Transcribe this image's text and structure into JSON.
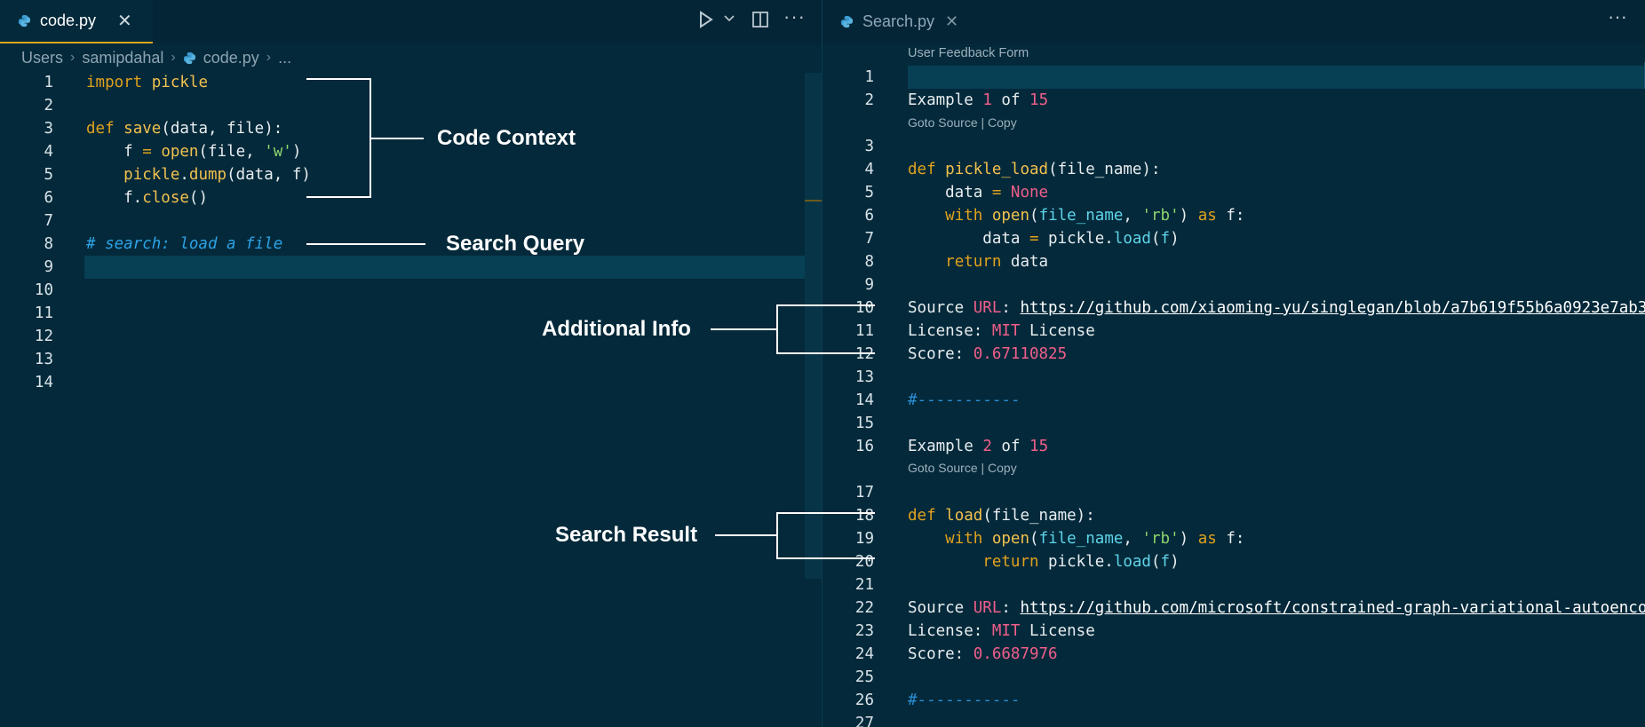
{
  "left_editor": {
    "tab": {
      "label": "code.py"
    },
    "breadcrumb": {
      "items": [
        "Users",
        "samipdahal",
        "code.py",
        "..."
      ]
    },
    "line_numbers": [
      "1",
      "2",
      "3",
      "4",
      "5",
      "6",
      "7",
      "8",
      "9",
      "10",
      "11",
      "12",
      "13",
      "14"
    ]
  },
  "right_editor": {
    "tab": {
      "label": "Search.py"
    },
    "header": "User Feedback Form",
    "line_numbers": [
      "1",
      "2",
      "3",
      "4",
      "5",
      "6",
      "7",
      "8",
      "9",
      "10",
      "11",
      "12",
      "13",
      "14",
      "15",
      "16",
      "17",
      "18",
      "19",
      "20",
      "21",
      "22",
      "23",
      "24",
      "25",
      "26",
      "27"
    ],
    "example1": {
      "example_word": "Example",
      "index": "1",
      "of_word": "of",
      "total": "15"
    },
    "example2": {
      "example_word": "Example",
      "index": "2",
      "of_word": "of",
      "total": "15"
    },
    "code_lens": "Goto Source | Copy",
    "result1": {
      "url": "https://github.com/xiaoming-yu/singlegan/blob/a7b619f55b6a0923e7ab3",
      "license_value": "MIT",
      "score": "0.67110825"
    },
    "result2": {
      "url": "https://github.com/microsoft/constrained-graph-variational-autoenco",
      "license_value": "MIT",
      "score": "0.6687976"
    },
    "separator": "#-----------"
  },
  "annotations": {
    "code_context": "Code Context",
    "search_query": "Search Query",
    "additional_info": "Additional Info",
    "search_result": "Search Result"
  },
  "colors": {
    "background": "#03293a",
    "tab_accent": "#d9a520",
    "keyword": "#e0a21e",
    "string": "#8fd46d",
    "number": "#f05e8a",
    "comment": "#2ea3e6"
  },
  "icons": [
    "python-file-icon",
    "close-icon",
    "run-icon",
    "chevron-down-icon",
    "split-editor-icon",
    "more-actions-icon",
    "chevron-right-icon"
  ]
}
